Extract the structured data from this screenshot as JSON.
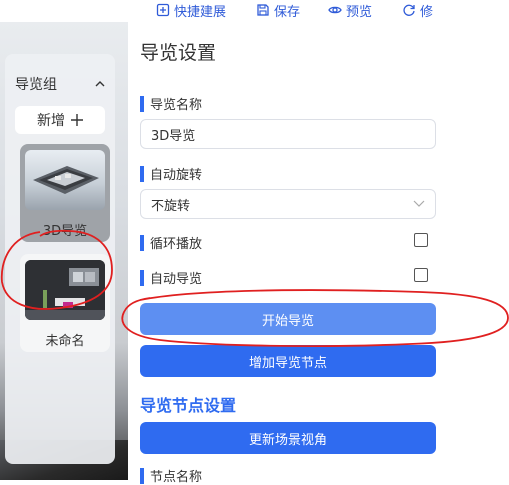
{
  "toolbar": {
    "quick_build": "快捷建展",
    "save": "保存",
    "preview": "预览",
    "modify": "修"
  },
  "sidebar": {
    "group_title": "导览组",
    "add_label": "新增",
    "items": [
      {
        "label": "3D导览",
        "selected": true
      },
      {
        "label": "未命名",
        "selected": false
      }
    ]
  },
  "panel": {
    "title": "导览设置",
    "name_label": "导览名称",
    "name_value": "3D导览",
    "rotate_label": "自动旋转",
    "rotate_value": "不旋转",
    "loop_label": "循环播放",
    "loop_checked": false,
    "autoplay_label": "自动导览",
    "autoplay_checked": false,
    "start_button": "开始导览",
    "add_node_button": "增加导览节点",
    "node_section_title": "导览节点设置",
    "update_view_button": "更新场景视角",
    "node_name_label": "节点名称"
  },
  "colors": {
    "accent": "#2f6bf0",
    "annotation": "#e02020"
  }
}
